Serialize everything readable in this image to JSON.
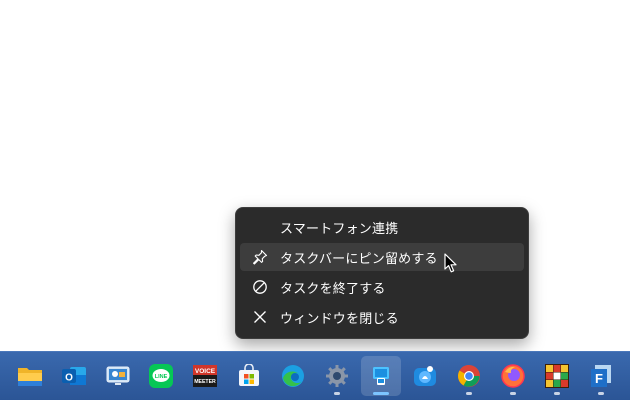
{
  "context_menu": {
    "items": [
      {
        "label": "スマートフォン連携",
        "icon": "none"
      },
      {
        "label": "タスクバーにピン留めする",
        "icon": "pin-icon"
      },
      {
        "label": "タスクを終了する",
        "icon": "prohibited-icon"
      },
      {
        "label": "ウィンドウを閉じる",
        "icon": "close-icon"
      }
    ]
  },
  "taskbar": {
    "apps": [
      {
        "name": "file-explorer",
        "running": false
      },
      {
        "name": "outlook",
        "running": false
      },
      {
        "name": "remote-desktop",
        "running": false
      },
      {
        "name": "line",
        "running": false
      },
      {
        "name": "voicemeeter",
        "running": false,
        "text_top": "VOICE",
        "text_bottom": "MEETER"
      },
      {
        "name": "microsoft-store",
        "running": false
      },
      {
        "name": "edge",
        "running": false
      },
      {
        "name": "settings",
        "running": true
      },
      {
        "name": "phone-link",
        "running": true,
        "active": true
      },
      {
        "name": "pictures-app",
        "running": false
      },
      {
        "name": "chrome",
        "running": true
      },
      {
        "name": "firefox",
        "running": true
      },
      {
        "name": "game-app",
        "running": true
      },
      {
        "name": "f-app",
        "running": true,
        "letter": "F"
      }
    ]
  },
  "colors": {
    "menu_bg": "#2b2b2b",
    "menu_hover": "#3d3d3d",
    "taskbar_bg": "#2f5c9e",
    "accent": "#7cc4ff"
  }
}
